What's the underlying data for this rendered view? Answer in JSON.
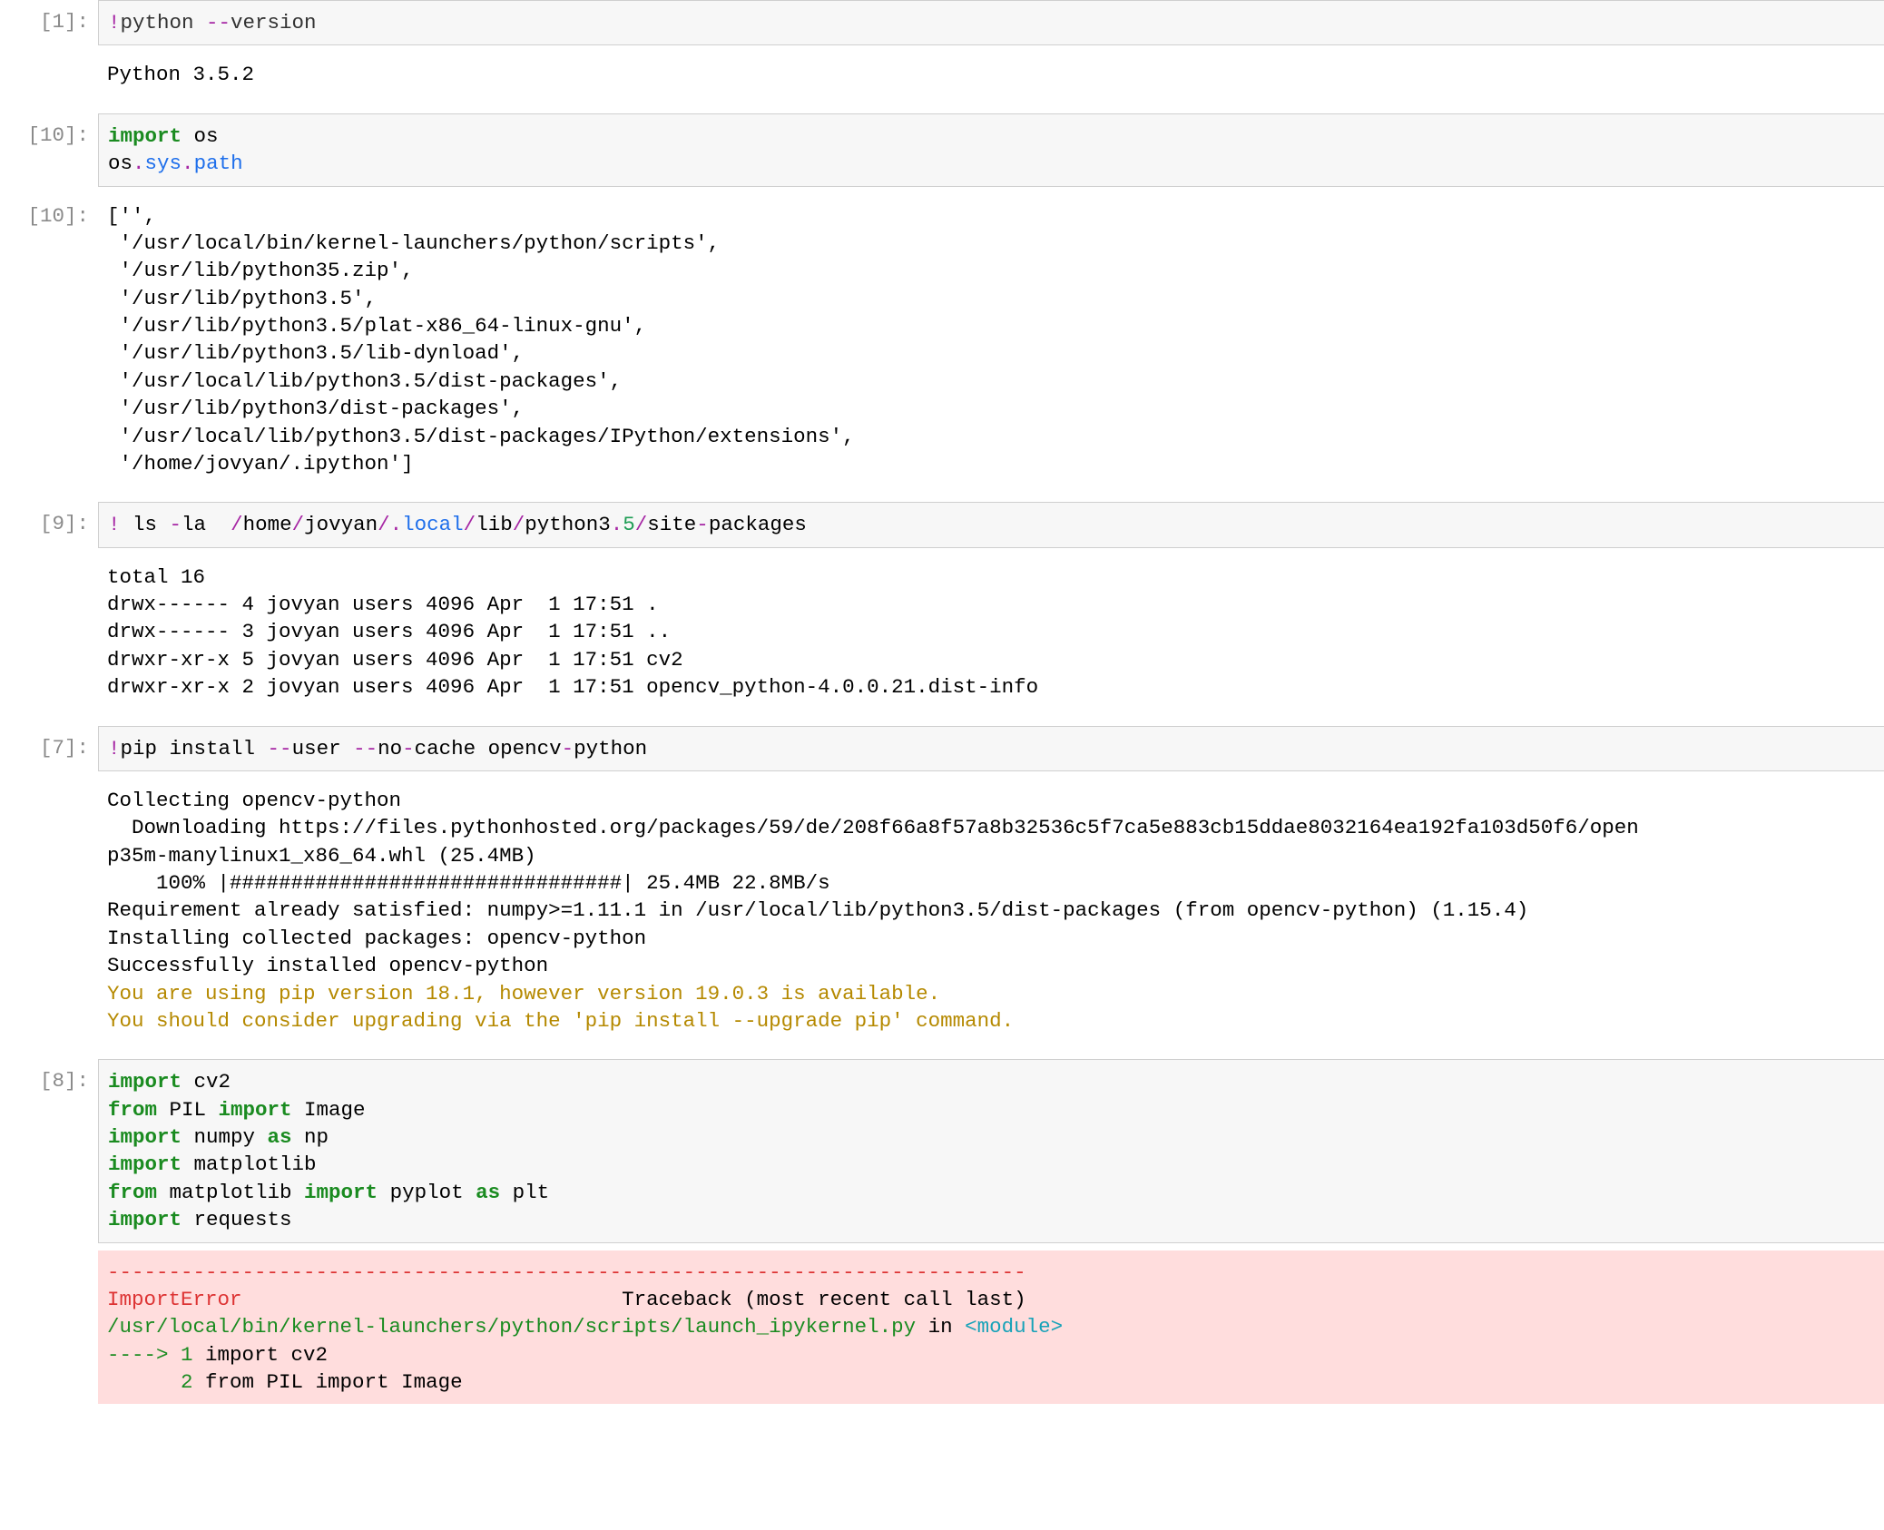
{
  "cells": {
    "c1": {
      "prompt": "[1]:",
      "in_bang": "!",
      "in_cmd": "python ",
      "in_dash": "--",
      "in_rest": "version",
      "out": "Python 3.5.2"
    },
    "c2": {
      "prompt": "[10]:",
      "in_kw": "import",
      "in_os": " os",
      "l2_os": "os",
      "l2_sys": "sys",
      "l2_path": "path",
      "dot": "."
    },
    "c3": {
      "prompt": "[10]:",
      "out": "['',\n '/usr/local/bin/kernel-launchers/python/scripts',\n '/usr/lib/python35.zip',\n '/usr/lib/python3.5',\n '/usr/lib/python3.5/plat-x86_64-linux-gnu',\n '/usr/lib/python3.5/lib-dynload',\n '/usr/local/lib/python3.5/dist-packages',\n '/usr/lib/python3/dist-packages',\n '/usr/local/lib/python3.5/dist-packages/IPython/extensions',\n '/home/jovyan/.ipython']"
    },
    "c4": {
      "prompt": "[9]:",
      "bang": "!",
      "sp": " ls ",
      "dash1": "-",
      "la": "la  ",
      "p_home": "home",
      "p_jovyan": "jovyan",
      "p_local": "local",
      "p_lib": "lib",
      "p_python": "python3",
      "p_five": "5",
      "p_site": "site",
      "p_packages": "packages",
      "slash": "/",
      "dotp": ".",
      "out": "total 16\ndrwx------ 4 jovyan users 4096 Apr  1 17:51 .\ndrwx------ 3 jovyan users 4096 Apr  1 17:51 ..\ndrwxr-xr-x 5 jovyan users 4096 Apr  1 17:51 cv2\ndrwxr-xr-x 2 jovyan users 4096 Apr  1 17:51 opencv_python-4.0.0.21.dist-info"
    },
    "c5": {
      "prompt": "[7]:",
      "bang": "!",
      "pip": "pip install ",
      "dd1": "--",
      "user": "user ",
      "dd2": "--",
      "no": "no",
      "dash_c": "-",
      "cache": "cache opencv",
      "dash_p": "-",
      "python": "python",
      "out_norm": "Collecting opencv-python\n  Downloading https://files.pythonhosted.org/packages/59/de/208f66a8f57a8b32536c5f7ca5e883cb15ddae8032164ea192fa103d50f6/open\np35m-manylinux1_x86_64.whl (25.4MB)\n    100% |################################| 25.4MB 22.8MB/s\nRequirement already satisfied: numpy>=1.11.1 in /usr/local/lib/python3.5/dist-packages (from opencv-python) (1.15.4)\nInstalling collected packages: opencv-python\nSuccessfully installed opencv-python",
      "out_warn": "You are using pip version 18.1, however version 19.0.3 is available.\nYou should consider upgrading via the 'pip install --upgrade pip' command."
    },
    "c6": {
      "prompt": "[8]:",
      "import_kw": "import",
      "from_kw": "from",
      "as_kw": "as",
      "cv2": " cv2",
      "pil": " PIL ",
      "image": " Image",
      "numpy": " numpy ",
      "np": " np",
      "matplotlib": " matplotlib",
      "matplotlib2": " matplotlib ",
      "pyplot": " pyplot ",
      "plt": " plt",
      "requests": " requests"
    },
    "c7": {
      "dashes": "---------------------------------------------------------------------------",
      "err_name": "ImportError",
      "tb_label": "                               Traceback (most recent call last)",
      "file": "/usr/local/bin/kernel-launchers/python/scripts/launch_ipykernel.py",
      "in": " in ",
      "module": "<module>",
      "arrow": "----> ",
      "one": "1",
      "one_rest": " import cv2",
      "two_pad": "      ",
      "two": "2",
      "two_rest": " from PIL import Image"
    }
  }
}
